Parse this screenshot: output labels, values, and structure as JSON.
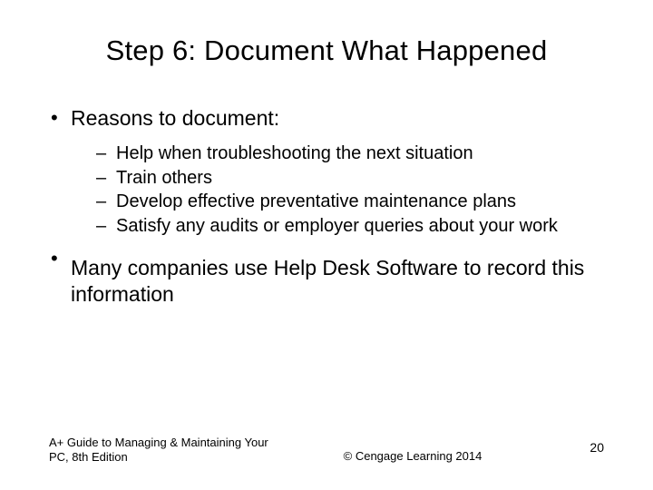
{
  "title": "Step 6: Document What Happened",
  "bullets": [
    {
      "text": "Reasons to document:",
      "sub": [
        "Help when troubleshooting the next situation",
        "Train others",
        "Develop effective preventative maintenance plans",
        "Satisfy any audits or employer queries about your work"
      ]
    },
    {
      "text": "Many companies use Help Desk Software to record this information",
      "sub": []
    }
  ],
  "footer": {
    "left": "A+ Guide to Managing & Maintaining Your PC, 8th Edition",
    "center": "© Cengage Learning 2014",
    "right": "20"
  }
}
